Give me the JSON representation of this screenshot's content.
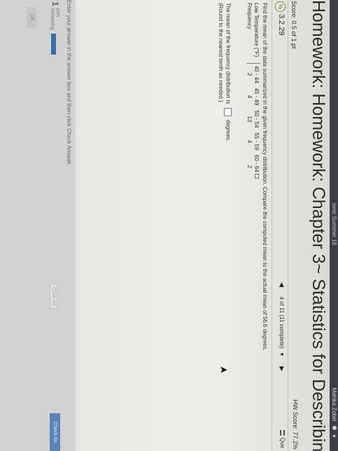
{
  "header": {
    "course_name": "ionic Summer 18",
    "user_name": "Mahika Zobel",
    "page_title": "Homework: Homework: Chapter 3~ Statistics for Describing, Exploring"
  },
  "score_bar": {
    "score": "Score: 0.5 of 1 pt",
    "hw_score": "HW Score: 77.2%"
  },
  "question_nav": {
    "question_number": "3.2.29",
    "badge": "½",
    "position_label": "4 of 11 (11 complete)",
    "question_menu_label": "Que"
  },
  "question": {
    "prompt": "Find the mean of the data summarized in the given frequency distribution. Compare the computed mean to the actual mean of 56.6 degrees.",
    "row_labels": [
      "Low Temperature (°F)",
      "Frequency"
    ],
    "classes": [
      "40 - 44",
      "45 - 49",
      "50 - 54",
      "55 - 59",
      "60 - 64"
    ],
    "frequencies": [
      "2",
      "4",
      "13",
      "4",
      "2"
    ],
    "answer_prefix": "The mean of the frequency distribution is",
    "answer_value": "",
    "answer_unit": "degrees.",
    "round_note": "(Round to the nearest tenth as needed.)"
  },
  "footer": {
    "instructions": "Enter your answer in the answer box and then click Check Answer.",
    "parts_count": "1",
    "parts_label_1": "part",
    "parts_label_2": "remaining",
    "progress_fraction": 1.0,
    "clear_all_label": "Clear All",
    "check_answer_label": "Check An",
    "ok_label": "OK"
  }
}
